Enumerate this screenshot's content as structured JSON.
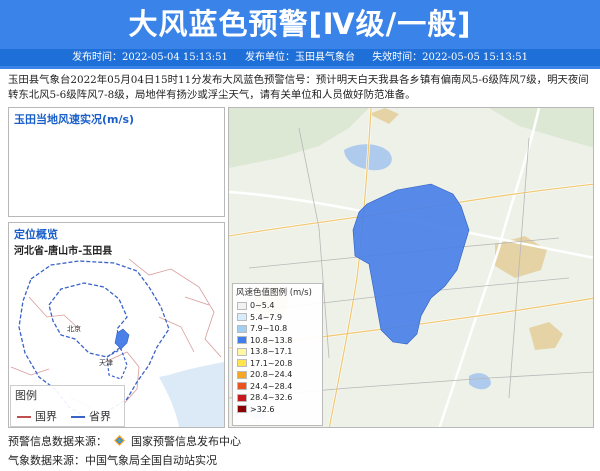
{
  "header": {
    "title": "大风蓝色预警[Ⅳ级/一般]",
    "publish_time": "发布时间：2022-05-04 15:13:51",
    "publisher": "发布单位：玉田县气象台",
    "expire_time": "失效时间：2022-05-05 15:13:51"
  },
  "description": "玉田县气象台2022年05月04日15时11分发布大风蓝色预警信号：预计明天白天我县各乡镇有偏南风5-6级阵风7级，明天夜间转东北风5-6级阵风7-8级，局地伴有扬沙或浮尘天气，请有关单位和人员做好防范准备。",
  "wind_panel": {
    "title": "玉田当地风速实况(m/s)"
  },
  "location_panel": {
    "title": "定位概览",
    "subtitle": "河北省-唐山市-玉田县",
    "map_labels": [
      "北京",
      "天津"
    ]
  },
  "boundary_legend": {
    "title": "图例",
    "items": [
      {
        "label": "国界",
        "color": "#c0504d"
      },
      {
        "label": "省界",
        "color": "#3a63c8"
      }
    ]
  },
  "speed_legend": {
    "title": "风速色值图例 (m/s)",
    "items": [
      {
        "label": "0~5.4",
        "color": "#f2f2f2"
      },
      {
        "label": "5.4~7.9",
        "color": "#d9ecfb"
      },
      {
        "label": "7.9~10.8",
        "color": "#9fcff2"
      },
      {
        "label": "10.8~13.8",
        "color": "#3f7ee8"
      },
      {
        "label": "13.8~17.1",
        "color": "#fff6a6"
      },
      {
        "label": "17.1~20.8",
        "color": "#ffe44d"
      },
      {
        "label": "20.8~24.4",
        "color": "#f5a623"
      },
      {
        "label": "24.4~28.4",
        "color": "#e8531e"
      },
      {
        "label": "28.4~32.6",
        "color": "#c9171e"
      },
      {
        "label": ">32.6",
        "color": "#8b0000"
      }
    ]
  },
  "footer": {
    "warning_source": "预警信息数据来源：",
    "warning_source_name": "国家预警信息发布中心",
    "weather_source": "气象数据来源：中国气象局全国自动站实况"
  },
  "colors": {
    "header_bg": "#3a83e8",
    "meta_bg": "#1f6fd8",
    "accent": "#1a5fc9",
    "county_fill": "#4a80e8"
  }
}
